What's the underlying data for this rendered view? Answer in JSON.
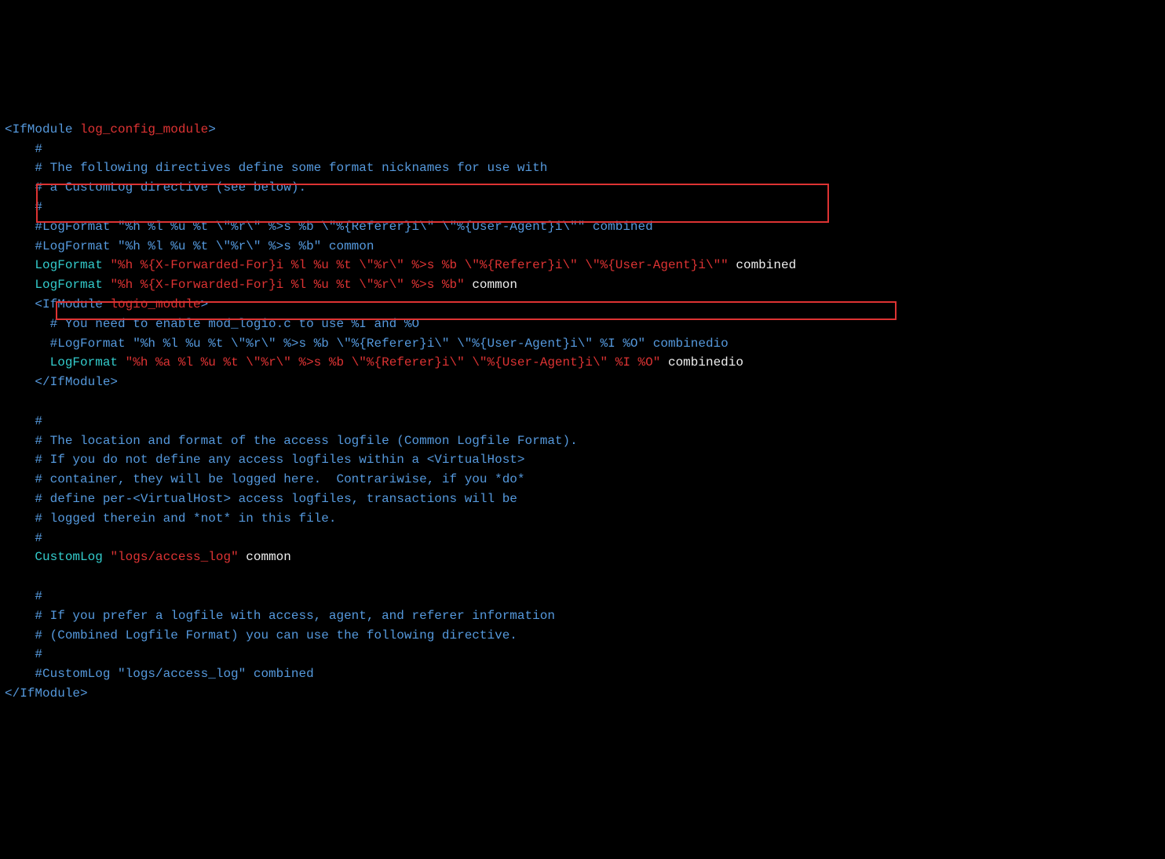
{
  "lines": [
    [
      {
        "cls": "tag",
        "t": "<IfModule "
      },
      {
        "cls": "module",
        "t": "log_config_module"
      },
      {
        "cls": "tag",
        "t": ">"
      }
    ],
    [
      {
        "cls": "comment",
        "t": "    #"
      }
    ],
    [
      {
        "cls": "comment",
        "t": "    # The following directives define some format nicknames for use with"
      }
    ],
    [
      {
        "cls": "comment",
        "t": "    # a CustomLog directive (see below)."
      }
    ],
    [
      {
        "cls": "comment",
        "t": "    #"
      }
    ],
    [
      {
        "cls": "comment",
        "t": "    #LogFormat \"%h %l %u %t \\\"%r\\\" %>s %b \\\"%{Referer}i\\\" \\\"%{User-Agent}i\\\"\" combined"
      }
    ],
    [
      {
        "cls": "comment",
        "t": "    #LogFormat \"%h %l %u %t \\\"%r\\\" %>s %b\" common"
      }
    ],
    [
      {
        "cls": "literal",
        "t": "    "
      },
      {
        "cls": "directive",
        "t": "LogFormat"
      },
      {
        "cls": "literal",
        "t": " "
      },
      {
        "cls": "quoted",
        "t": "\"%h %{X-Forwarded-For}i %l %u %t \\\"%r\\\" %>s %b \\\"%{Referer}i\\\" \\\"%{User-Agent}i\\\"\""
      },
      {
        "cls": "literal",
        "t": " combined"
      }
    ],
    [
      {
        "cls": "literal",
        "t": "    "
      },
      {
        "cls": "directive",
        "t": "LogFormat"
      },
      {
        "cls": "literal",
        "t": " "
      },
      {
        "cls": "quoted",
        "t": "\"%h %{X-Forwarded-For}i %l %u %t \\\"%r\\\" %>s %b\""
      },
      {
        "cls": "literal",
        "t": " common"
      }
    ],
    [
      {
        "cls": "literal",
        "t": "    "
      },
      {
        "cls": "tag",
        "t": "<IfModule "
      },
      {
        "cls": "module",
        "t": "logio_module"
      },
      {
        "cls": "tag",
        "t": ">"
      }
    ],
    [
      {
        "cls": "comment",
        "t": "      # You need to enable mod_logio.c to use %I and %O"
      }
    ],
    [
      {
        "cls": "comment",
        "t": "      #LogFormat \"%h %l %u %t \\\"%r\\\" %>s %b \\\"%{Referer}i\\\" \\\"%{User-Agent}i\\\" %I %O\" combinedio"
      }
    ],
    [
      {
        "cls": "literal",
        "t": "      "
      },
      {
        "cls": "directive",
        "t": "LogFormat"
      },
      {
        "cls": "literal",
        "t": " "
      },
      {
        "cls": "quoted",
        "t": "\"%h %a %l %u %t \\\"%r\\\" %>s %b \\\"%{Referer}i\\\" \\\"%{User-Agent}i\\\" %I %O\""
      },
      {
        "cls": "literal",
        "t": " combinedio"
      }
    ],
    [
      {
        "cls": "literal",
        "t": "    "
      },
      {
        "cls": "close-tag",
        "t": "</IfModule>"
      }
    ],
    [
      {
        "cls": "literal",
        "t": ""
      }
    ],
    [
      {
        "cls": "comment",
        "t": "    #"
      }
    ],
    [
      {
        "cls": "comment",
        "t": "    # The location and format of the access logfile (Common Logfile Format)."
      }
    ],
    [
      {
        "cls": "comment",
        "t": "    # If you do not define any access logfiles within a <VirtualHost>"
      }
    ],
    [
      {
        "cls": "comment",
        "t": "    # container, they will be logged here.  Contrariwise, if you *do*"
      }
    ],
    [
      {
        "cls": "comment",
        "t": "    # define per-<VirtualHost> access logfiles, transactions will be"
      }
    ],
    [
      {
        "cls": "comment",
        "t": "    # logged therein and *not* in this file."
      }
    ],
    [
      {
        "cls": "comment",
        "t": "    #"
      }
    ],
    [
      {
        "cls": "literal",
        "t": "    "
      },
      {
        "cls": "directive",
        "t": "CustomLog"
      },
      {
        "cls": "literal",
        "t": " "
      },
      {
        "cls": "quoted",
        "t": "\"logs/access_log\""
      },
      {
        "cls": "literal",
        "t": " common"
      }
    ],
    [
      {
        "cls": "literal",
        "t": ""
      }
    ],
    [
      {
        "cls": "comment",
        "t": "    #"
      }
    ],
    [
      {
        "cls": "comment",
        "t": "    # If you prefer a logfile with access, agent, and referer information"
      }
    ],
    [
      {
        "cls": "comment",
        "t": "    # (Combined Logfile Format) you can use the following directive."
      }
    ],
    [
      {
        "cls": "comment",
        "t": "    #"
      }
    ],
    [
      {
        "cls": "comment",
        "t": "    #CustomLog \"logs/access_log\" combined"
      }
    ],
    [
      {
        "cls": "close-tag",
        "t": "</IfModule>"
      }
    ]
  ]
}
